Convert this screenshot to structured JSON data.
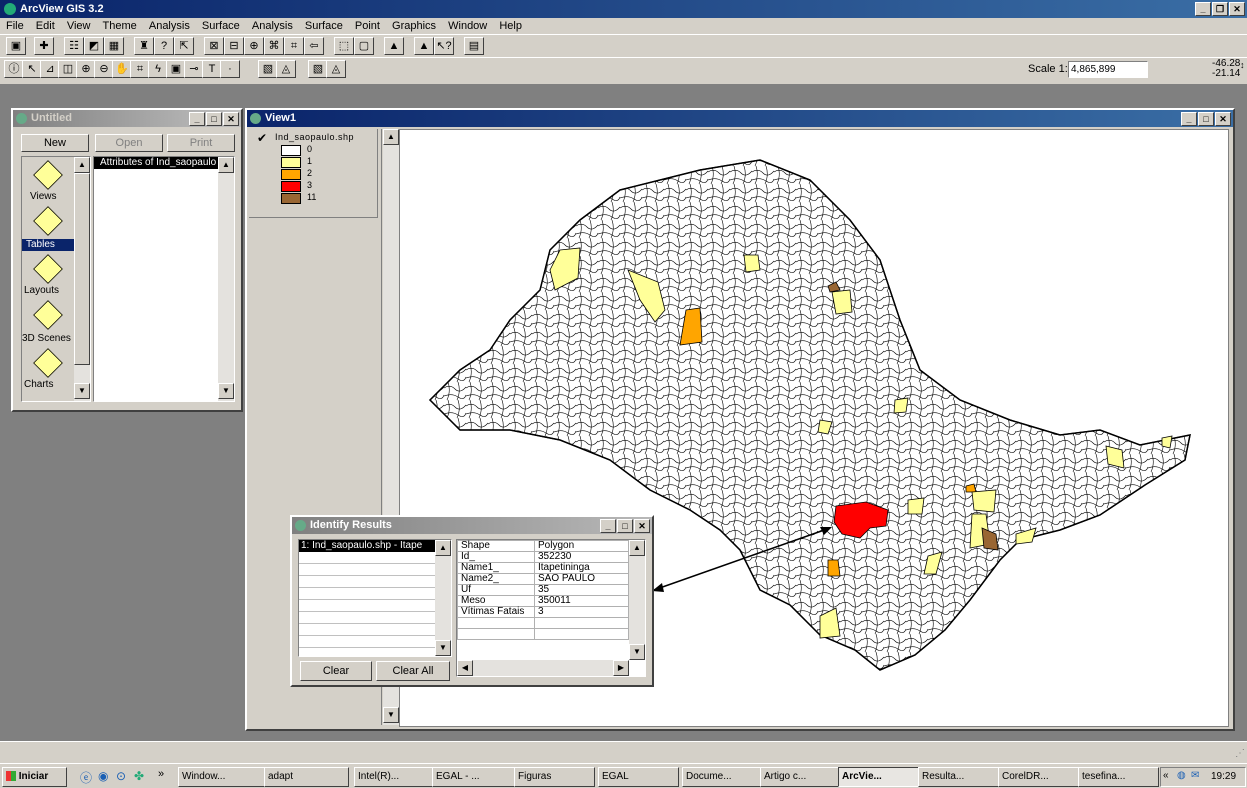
{
  "app": {
    "title": "ArcView GIS 3.2"
  },
  "menu": [
    "File",
    "Edit",
    "View",
    "Theme",
    "Analysis",
    "Surface",
    "Analysis",
    "Surface",
    "Point",
    "Graphics",
    "Window",
    "Help"
  ],
  "scale": {
    "label": "Scale 1:",
    "value": "4,865,899",
    "coord_x": "-46.28",
    "coord_y": "-21.14"
  },
  "project": {
    "title": "Untitled",
    "buttons": {
      "new": "New",
      "open": "Open",
      "print": "Print"
    },
    "types": [
      "Views",
      "Tables",
      "Layouts",
      "3D Scenes",
      "Charts"
    ],
    "selected": "Tables",
    "list_item": "Attributes of Ind_saopaulo"
  },
  "view": {
    "title": "View1",
    "theme": "Ind_saopaulo.shp",
    "legend": [
      {
        "label": "0",
        "color": "#ffffff"
      },
      {
        "label": "1",
        "color": "#ffff99"
      },
      {
        "label": "2",
        "color": "#ffa500"
      },
      {
        "label": "3",
        "color": "#ff0000"
      },
      {
        "label": "11",
        "color": "#996633"
      }
    ]
  },
  "identify": {
    "title": "Identify Results",
    "result": "1:  Ind_saopaulo.shp - Itape",
    "fields": [
      {
        "k": "Shape",
        "v": "Polygon"
      },
      {
        "k": "Id_",
        "v": "352230"
      },
      {
        "k": "Name1_",
        "v": "Itapetininga"
      },
      {
        "k": "Name2_",
        "v": "SAO PAULO"
      },
      {
        "k": "Uf",
        "v": "35"
      },
      {
        "k": "Meso",
        "v": "350011"
      },
      {
        "k": "Vítimas Fatais",
        "v": "3"
      }
    ],
    "clear": "Clear",
    "clear_all": "Clear All"
  },
  "taskbar": {
    "start": "Iniciar",
    "tasks": [
      "Window...",
      "adapt",
      "Intel(R)...",
      "EGAL - ...",
      "Figuras",
      "EGAL",
      "Docume...",
      "Artigo c...",
      "ArcVie...",
      "Resulta...",
      "CorelDR...",
      "tesefina..."
    ],
    "clock": "19:29"
  }
}
